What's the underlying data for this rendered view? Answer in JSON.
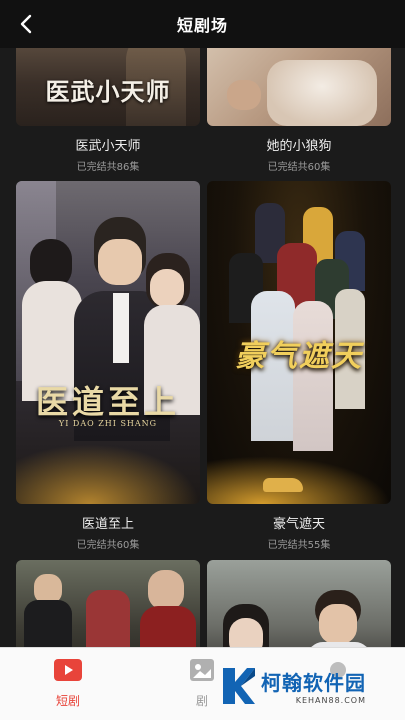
{
  "header": {
    "title": "短剧场"
  },
  "cards": [
    {
      "title": "医武小天师",
      "subtitle": "已完结共86集",
      "poster_text": "医武小天师"
    },
    {
      "title": "她的小狼狗",
      "subtitle": "已完结共60集"
    },
    {
      "title": "医道至上",
      "subtitle": "已完结共60集",
      "poster_text": "医道至上",
      "poster_subtext": "YI DAO ZHI SHANG"
    },
    {
      "title": "豪气遮天",
      "subtitle": "已完结共55集",
      "poster_text": "豪气遮天"
    }
  ],
  "tabs": [
    {
      "label": "短剧",
      "active": true,
      "icon": "play-icon"
    },
    {
      "label": "剧",
      "active": false,
      "icon": "image-icon"
    }
  ],
  "watermark": {
    "name": "柯翰软件园",
    "url": "KEHAN88.COM"
  },
  "colors": {
    "active_tab": "#e8443a",
    "inactive_tab": "#999999",
    "background": "#1b1b1b"
  }
}
